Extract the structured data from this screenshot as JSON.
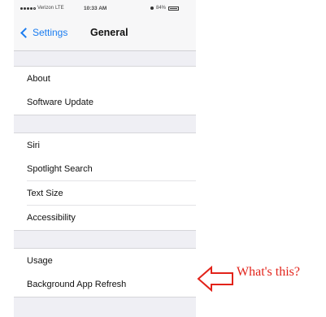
{
  "status_bar": {
    "carrier": "Verizon",
    "network": "LTE",
    "time": "10:33 AM",
    "battery": "84%"
  },
  "nav_bar": {
    "back_label": "Settings",
    "title": "General"
  },
  "groups": [
    {
      "items": [
        "About",
        "Software Update"
      ]
    },
    {
      "items": [
        "Siri",
        "Spotlight Search",
        "Text Size",
        "Accessibility"
      ]
    },
    {
      "items": [
        "Usage",
        "Background App Refresh"
      ]
    }
  ],
  "annotation": {
    "text": "What's this?",
    "color": "#e2231a"
  },
  "colors": {
    "accent": "#1a7cf0",
    "background": "#efeff4"
  }
}
